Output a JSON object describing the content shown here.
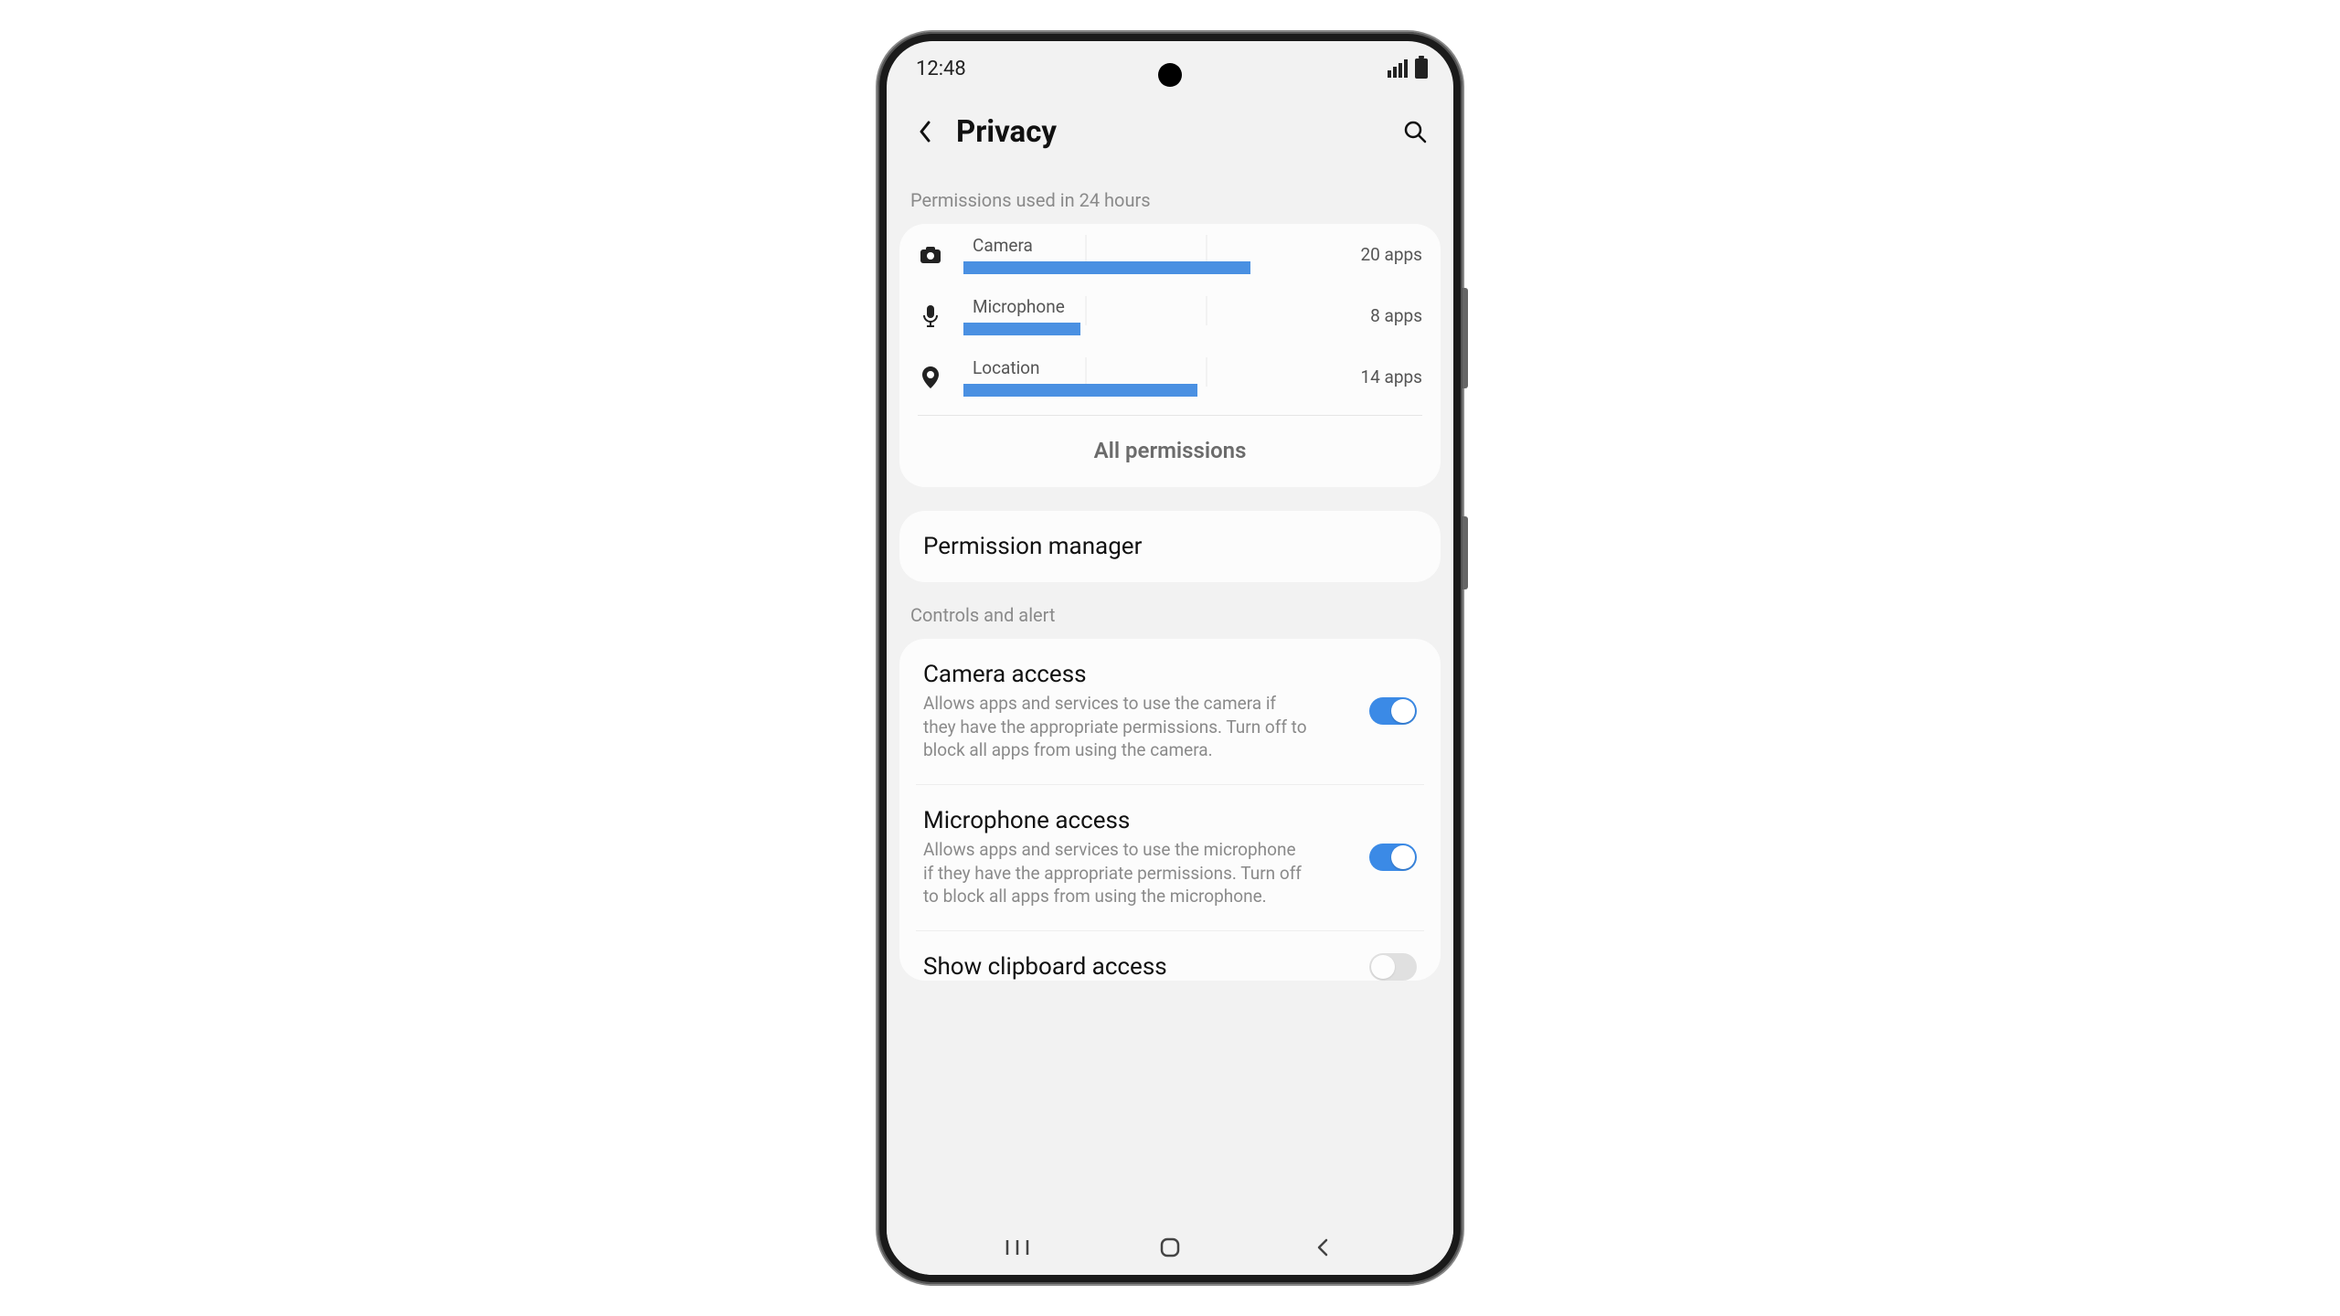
{
  "status": {
    "time": "12:48"
  },
  "header": {
    "title": "Privacy"
  },
  "permissions_section": {
    "label": "Permissions used in 24 hours",
    "rows": [
      {
        "icon": "camera",
        "name": "Camera",
        "count": "20 apps",
        "bar_pct": 98
      },
      {
        "icon": "microphone",
        "name": "Microphone",
        "count": "8 apps",
        "bar_pct": 40
      },
      {
        "icon": "location",
        "name": "Location",
        "count": "14 apps",
        "bar_pct": 80
      }
    ],
    "all_label": "All permissions"
  },
  "permission_manager": {
    "title": "Permission manager"
  },
  "controls_section": {
    "label": "Controls and alert",
    "items": [
      {
        "title": "Camera access",
        "desc": "Allows apps and services to use the camera if they have the appropriate permissions. Turn off to block all apps from using the camera.",
        "on": true
      },
      {
        "title": "Microphone access",
        "desc": "Allows apps and services to use the microphone if they have the appropriate permissions. Turn off to block all apps from using the microphone.",
        "on": true
      },
      {
        "title": "Show clipboard access",
        "desc": "",
        "on": false
      }
    ]
  },
  "colors": {
    "bar": "#4a90e2",
    "toggle_on": "#3b8ae6"
  }
}
